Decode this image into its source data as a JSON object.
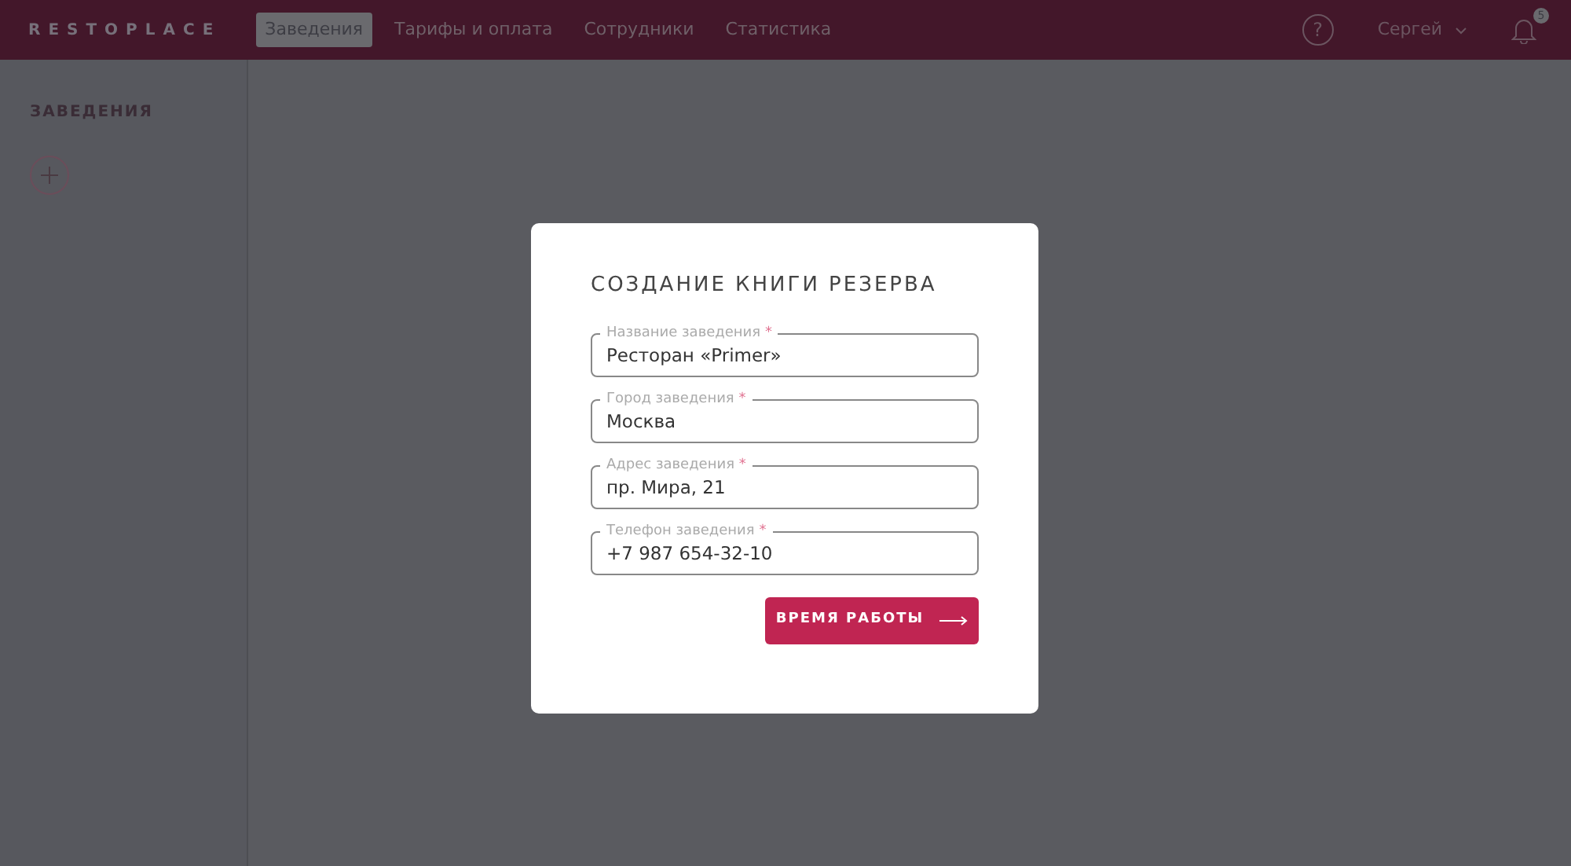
{
  "navbar": {
    "logo": "RESTOPLACE",
    "tabs": [
      {
        "label": "Заведения",
        "selected": true
      },
      {
        "label": "Тарифы и оплата",
        "selected": false
      },
      {
        "label": "Сотрудники",
        "selected": false
      },
      {
        "label": "Статистика",
        "selected": false
      }
    ],
    "help": "?",
    "user": "Сергей",
    "notifications_count": "5"
  },
  "sidebar": {
    "title": "ЗАВЕДЕНИЯ"
  },
  "modal": {
    "title": "СОЗДАНИЕ КНИГИ РЕЗЕРВА",
    "fields": [
      {
        "label": "Название заведения",
        "mark": "*",
        "value": "Ресторан «Primer»"
      },
      {
        "label": "Город заведения",
        "mark": "*",
        "value": "Москва"
      },
      {
        "label": "Адрес заведения",
        "mark": "*",
        "value": "пр. Мира, 21"
      },
      {
        "label": "Телефон заведения",
        "mark": "*",
        "value": "+7 987 654-32-10"
      }
    ],
    "button": "ВРЕМЯ РАБОТЫ"
  }
}
